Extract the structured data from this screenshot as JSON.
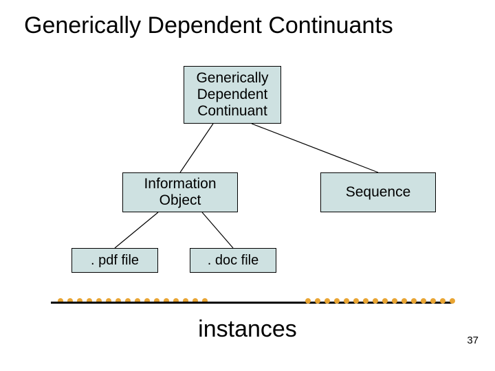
{
  "title": "Generically Dependent Continuants",
  "nodes": {
    "root": "Generically\nDependent\nContinuant",
    "info": "Information\nObject",
    "seq": "Sequence",
    "pdf": ". pdf file",
    "doc": ". doc file"
  },
  "footer_label": "instances",
  "page_number": "37",
  "dot_count": 16,
  "colors": {
    "node_fill": "#cee1e1",
    "dot": "#e9a533"
  }
}
